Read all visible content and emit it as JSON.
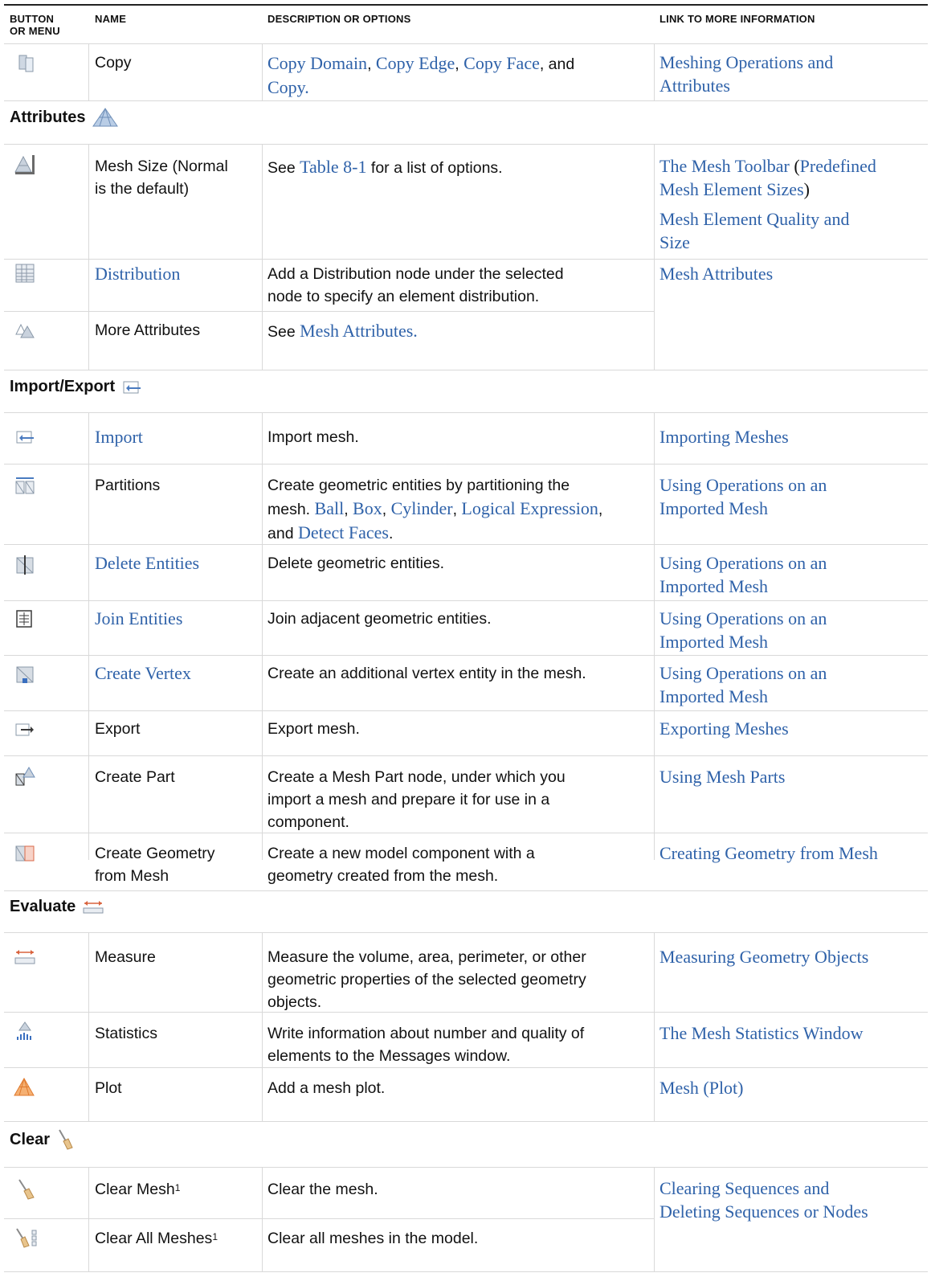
{
  "colors": {
    "link": "#2f62a9",
    "rule": "#d9d9d9",
    "topRule": "#222222"
  },
  "header": {
    "col1": "BUTTON OR MENU",
    "col1a": "BUTTON",
    "col1b": "OR MENU",
    "col2": "NAME",
    "col3": "DESCRIPTION OR OPTIONS",
    "col4": "LINK TO MORE INFORMATION"
  },
  "rows": {
    "copy": {
      "icon": "copy-domain-icon",
      "name": "Copy",
      "desc": {
        "a": "Copy Domain",
        "b": ", ",
        "c": "Copy Edge",
        "d": ", ",
        "e": "Copy Face",
        "f": ", and",
        "g": "Copy",
        "h": "."
      },
      "link": [
        "Meshing Operations and",
        "Attributes"
      ]
    },
    "mesh_size": {
      "icon": "mesh-size-icon",
      "name": [
        "Mesh Size (Normal",
        "is the default)"
      ],
      "desc": {
        "a": "See ",
        "b": "Table 8-1",
        "c": " for a list of options."
      },
      "link1": {
        "a": "The Mesh Toolbar",
        "b": " (",
        "c": "Predefined",
        "d": "Mesh Element Sizes",
        "e": ")"
      },
      "link2": [
        "Mesh Element Quality and",
        "Size"
      ]
    },
    "distribution": {
      "icon": "distribution-icon",
      "name": "Distribution",
      "desc": [
        "Add a Distribution node under the selected",
        "node to specify an element distribution."
      ],
      "link": "Mesh Attributes"
    },
    "more_attributes": {
      "icon": "more-attributes-icon",
      "name": "More Attributes",
      "desc": {
        "a": "See ",
        "b": "Mesh Attributes",
        "c": "."
      }
    },
    "import": {
      "icon": "import-icon",
      "name": "Import",
      "desc": "Import mesh.",
      "link": "Importing Meshes"
    },
    "partitions": {
      "icon": "partitions-icon",
      "name": "Partitions",
      "desc": {
        "l1": "Create geometric entities by partitioning the",
        "l2a": "mesh. ",
        "l2b": "Ball",
        "l2c": ", ",
        "l2d": "Box",
        "l2e": ", ",
        "l2f": "Cylinder",
        "l2g": ", ",
        "l2h": "Logical Expression",
        "l2i": ",",
        "l3a": "and ",
        "l3b": "Detect Faces",
        "l3c": "."
      },
      "link": [
        "Using Operations on an",
        "Imported Mesh"
      ]
    },
    "delete_entities": {
      "icon": "delete-entities-icon",
      "name": "Delete Entities",
      "desc": "Delete geometric entities.",
      "link": [
        "Using Operations on an",
        "Imported Mesh"
      ]
    },
    "join_entities": {
      "icon": "join-entities-icon",
      "name": "Join Entities",
      "desc": "Join adjacent geometric entities.",
      "link": [
        "Using Operations on an",
        "Imported Mesh"
      ]
    },
    "create_vertex": {
      "icon": "create-vertex-icon",
      "name": "Create Vertex",
      "desc": "Create an additional vertex entity in the mesh.",
      "link": [
        "Using Operations on an",
        "Imported Mesh"
      ]
    },
    "export": {
      "icon": "export-icon",
      "name": "Export",
      "desc": "Export mesh.",
      "link": "Exporting Meshes"
    },
    "create_part": {
      "icon": "create-part-icon",
      "name": "Create Part",
      "desc": [
        "Create a Mesh Part node, under which you",
        "import a mesh and prepare it for use in a",
        "component."
      ],
      "link": "Using Mesh Parts"
    },
    "create_geometry": {
      "icon": "create-geometry-icon",
      "name": [
        "Create Geometry",
        "from Mesh"
      ],
      "desc": [
        "Create a new model component with a",
        "geometry created from the mesh."
      ],
      "link": "Creating Geometry from Mesh"
    },
    "measure": {
      "icon": "measure-icon",
      "name": "Measure",
      "desc": [
        "Measure the volume, area, perimeter, or other",
        "geometric properties of the selected geometry",
        "objects."
      ],
      "link": "Measuring Geometry Objects"
    },
    "statistics": {
      "icon": "statistics-icon",
      "name": "Statistics",
      "desc": [
        "Write information about number and quality of",
        "elements to the Messages window."
      ],
      "link": "The Mesh Statistics Window"
    },
    "plot": {
      "icon": "mesh-plot-icon",
      "name": "Plot",
      "desc": "Add a mesh plot.",
      "link": "Mesh (Plot)"
    },
    "clear_mesh": {
      "icon": "broom-icon",
      "name": "Clear Mesh",
      "sup": "1",
      "desc": "Clear the mesh.",
      "link": [
        "Clearing Sequences and",
        "Deleting Sequences or Nodes"
      ]
    },
    "clear_all": {
      "icon": "broom-all-icon",
      "name": "Clear All Meshes",
      "sup": "1",
      "desc": "Clear all meshes in the model."
    }
  },
  "sections": {
    "attributes": {
      "label": "Attributes",
      "icon": "attributes-icon"
    },
    "import_export": {
      "label": "Import/Export",
      "icon": "import-export-icon"
    },
    "evaluate": {
      "label": "Evaluate",
      "icon": "evaluate-icon"
    },
    "clear": {
      "label": "Clear",
      "icon": "clear-icon"
    }
  }
}
